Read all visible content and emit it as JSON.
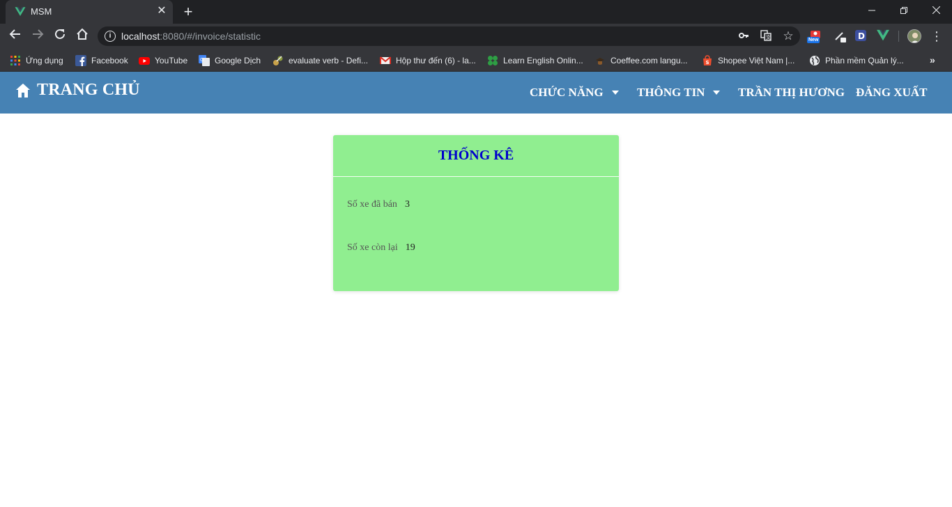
{
  "browser": {
    "tab": {
      "title": "MSM",
      "favicon": "vue-logo-icon"
    },
    "new_tab_label": "+",
    "address": {
      "host": "localhost",
      "path": ":8080/#/invoice/statistic"
    },
    "bookmarks": [
      {
        "label": "Ứng dụng",
        "icon": "apps-grid-icon"
      },
      {
        "label": "Facebook",
        "icon": "facebook-icon"
      },
      {
        "label": "YouTube",
        "icon": "youtube-icon"
      },
      {
        "label": "Google Dịch",
        "icon": "google-translate-icon"
      },
      {
        "label": "evaluate verb - Defi...",
        "icon": "dictionary-icon"
      },
      {
        "label": "Hộp thư đến (6) - la...",
        "icon": "gmail-icon"
      },
      {
        "label": "Learn English Onlin...",
        "icon": "clover-icon"
      },
      {
        "label": "Coeffee.com langu...",
        "icon": "coeffee-icon"
      },
      {
        "label": "Shopee Việt Nam |...",
        "icon": "shopee-icon"
      },
      {
        "label": "Phần mềm Quản lý...",
        "icon": "globe-icon"
      }
    ],
    "extension_badge": "New"
  },
  "navbar": {
    "brand": "TRANG CHỦ",
    "features": "CHỨC NĂNG",
    "info": "THÔNG TIN",
    "user": "TRẦN THỊ HƯƠNG",
    "logout": "ĐĂNG XUẤT",
    "background_color": "#4682b4"
  },
  "statistic": {
    "title": "THỐNG KÊ",
    "sold_label": "Số xe đã bán",
    "sold_value": "3",
    "remaining_label": "Số xe còn lại",
    "remaining_value": "19",
    "card_color": "#90ee90",
    "title_color": "#0000cd"
  }
}
